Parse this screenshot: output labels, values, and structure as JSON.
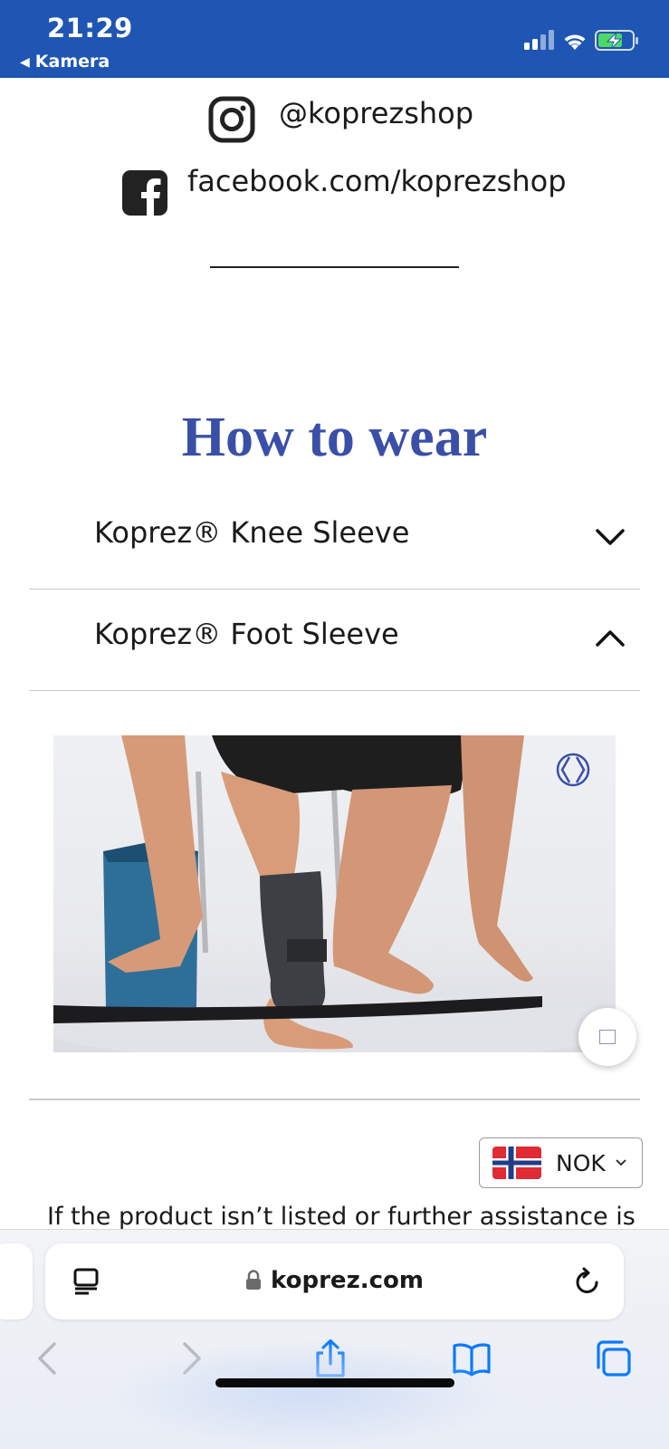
{
  "status_bar": {
    "time": "21:29",
    "back_label": "Kamera",
    "icons": [
      "signal-icon",
      "wifi-icon",
      "battery-charging-icon"
    ]
  },
  "social": {
    "instagram": "@koprezshop",
    "facebook": "facebook.com/koprezshop"
  },
  "how_to_wear": {
    "title": "How to wear",
    "items": [
      {
        "label": "Koprez® Knee Sleeve",
        "state": "collapsed"
      },
      {
        "label": "Koprez® Foot Sleeve",
        "state": "expanded"
      }
    ]
  },
  "currency": {
    "code": "NOK",
    "flag": "norway-flag-icon"
  },
  "body_text": "If the product isn’t listed or further assistance is",
  "browser": {
    "url": "koprez.com",
    "nav_icons": [
      "back-icon",
      "forward-icon",
      "share-icon",
      "bookmarks-icon",
      "tabs-icon"
    ]
  },
  "colors": {
    "status_bar": "#1f56b3",
    "title": "#3a4fa8",
    "safari_blue": "#0a7aff"
  }
}
